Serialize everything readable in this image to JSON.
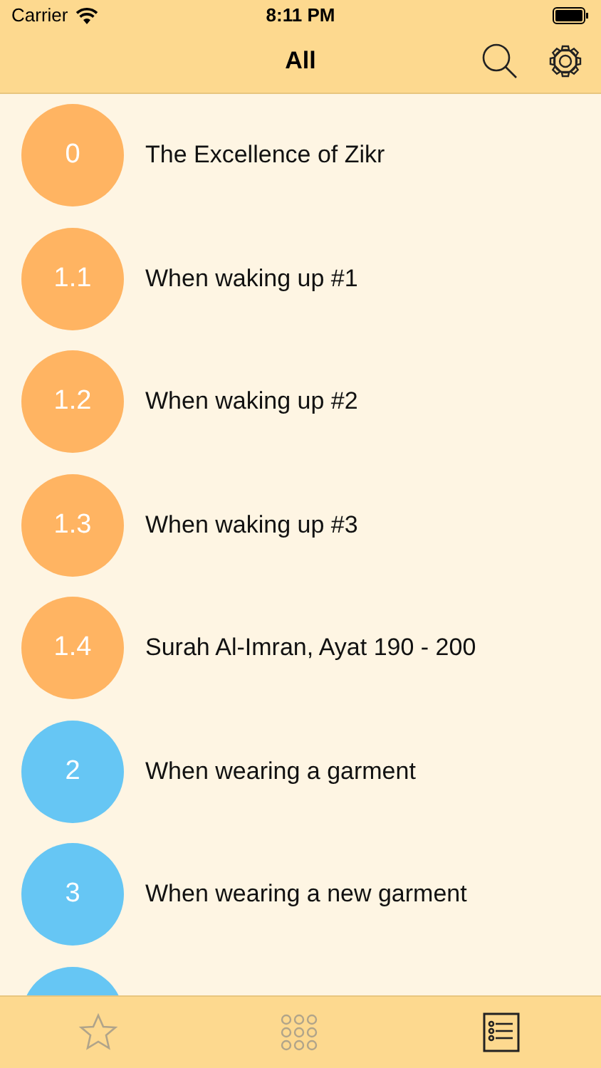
{
  "status_bar": {
    "carrier": "Carrier",
    "time": "8:11 PM"
  },
  "nav": {
    "title": "All"
  },
  "items": [
    {
      "number": "0",
      "title": "The Excellence of Zikr",
      "color": "#ffb462"
    },
    {
      "number": "1.1",
      "title": "When waking up #1",
      "color": "#ffb462"
    },
    {
      "number": "1.2",
      "title": "When waking up #2",
      "color": "#ffb462"
    },
    {
      "number": "1.3",
      "title": "When waking up #3",
      "color": "#ffb462"
    },
    {
      "number": "1.4",
      "title": "Surah Al-Imran, Ayat 190 - 200",
      "color": "#ffb462"
    },
    {
      "number": "2",
      "title": "When wearing a garment",
      "color": "#66c6f4"
    },
    {
      "number": "3",
      "title": "When wearing a new garment",
      "color": "#66c6f4"
    },
    {
      "color": "#66c6f4"
    }
  ],
  "tabs": [
    {
      "kind": "favorites",
      "selected": false
    },
    {
      "kind": "categories",
      "selected": false
    },
    {
      "kind": "list",
      "selected": true
    }
  ]
}
